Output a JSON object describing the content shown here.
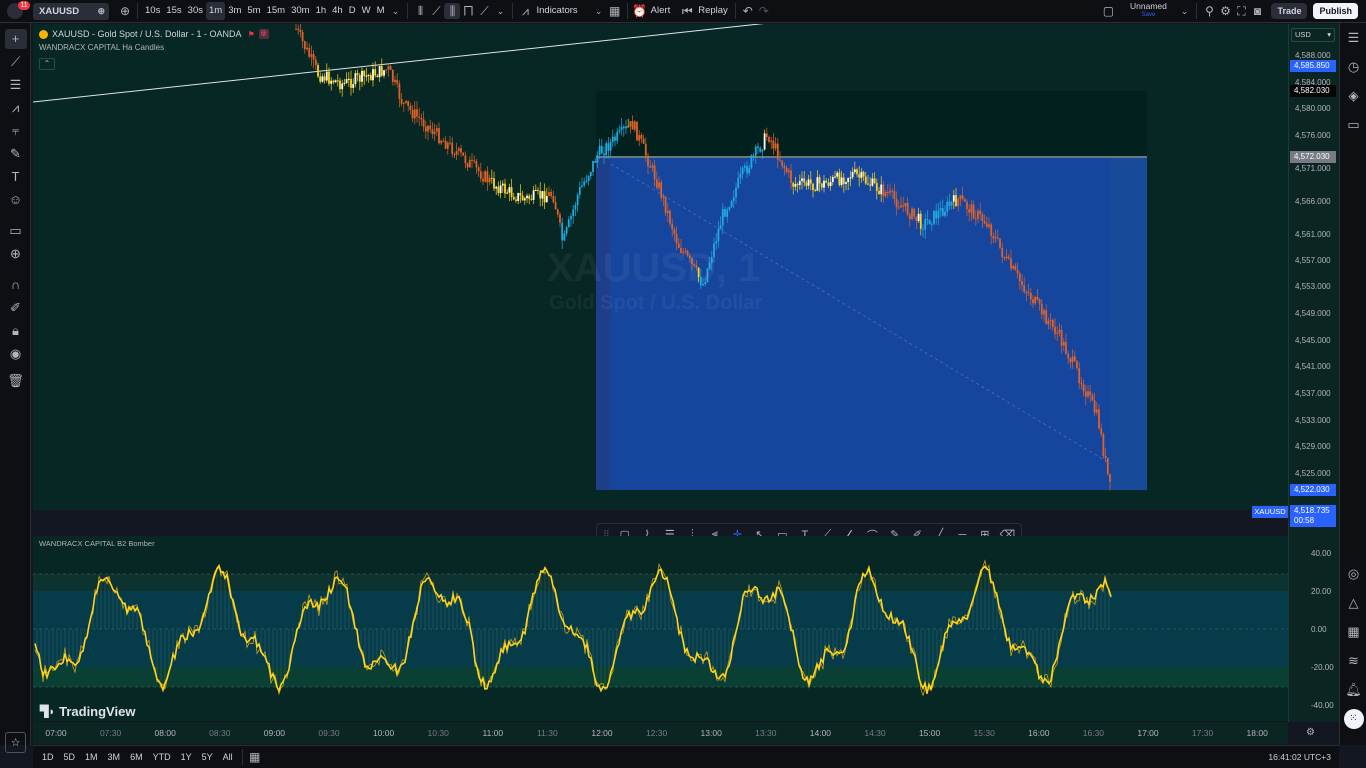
{
  "topbar": {
    "notification_count": "11",
    "symbol": "XAUUSD",
    "intervals": [
      "10s",
      "15s",
      "30s",
      "1m",
      "3m",
      "5m",
      "15m",
      "30m",
      "1h",
      "4h",
      "D",
      "W",
      "M"
    ],
    "active_interval": "1m",
    "indicators_label": "Indicators",
    "alert_label": "Alert",
    "replay_label": "Replay",
    "layout_name": "Unnamed",
    "layout_status": "Save",
    "trade_label": "Trade",
    "publish_label": "Publish"
  },
  "legend": {
    "title": "XAUUSD - Gold Spot / U.S. Dollar - 1 - OANDA",
    "indicator1": "WANDRACX CAPITAL Ha Candles",
    "indicator2": "WANDRACX CAPITAL B2 Bomber"
  },
  "watermark": {
    "line1": "XAUUSD, 1",
    "line2": "Gold Spot / U.S. Dollar"
  },
  "price_axis": {
    "currency": "USD",
    "labels": [
      "4,588.000",
      "4,584.000",
      "4,580.000",
      "4,576.000",
      "4,571.000",
      "4,566.000",
      "4,561.000",
      "4,557.000",
      "4,553.000",
      "4,549.000",
      "4,545.000",
      "4,541.000",
      "4,537.000",
      "4,533.000",
      "4,529.000",
      "4,525.000"
    ],
    "tags": [
      {
        "text": "4,585.850",
        "kind": "blue"
      },
      {
        "text": "4,582.030",
        "kind": "dark"
      },
      {
        "text": "4,572.030",
        "kind": "grey"
      },
      {
        "text": "4,522.030",
        "kind": "blue"
      }
    ],
    "last_price": "4,518.735",
    "countdown": "00:58",
    "symbol_tag": "XAUUSD"
  },
  "osc_axis": {
    "labels": [
      "40.00",
      "20.00",
      "0.00",
      "-20.00",
      "-40.00"
    ]
  },
  "time_axis": {
    "labels": [
      "07:00",
      "07:30",
      "08:00",
      "08:30",
      "09:00",
      "09:30",
      "10:00",
      "10:30",
      "11:00",
      "11:30",
      "12:00",
      "12:30",
      "13:00",
      "13:30",
      "14:00",
      "14:30",
      "15:00",
      "15:30",
      "16:00",
      "16:30",
      "17:00",
      "17:30",
      "18:00"
    ]
  },
  "bottombar": {
    "ranges": [
      "1D",
      "5D",
      "1M",
      "3M",
      "6M",
      "YTD",
      "1Y",
      "5Y",
      "All"
    ],
    "clock": "16:41:02 UTC+3"
  },
  "branding": {
    "logo_text": "TradingView"
  },
  "colors": {
    "bg": "#062723",
    "blue_box": "#1848a8",
    "up": "#21a9e1",
    "down": "#e0622a",
    "osc": "#ffd31a"
  }
}
